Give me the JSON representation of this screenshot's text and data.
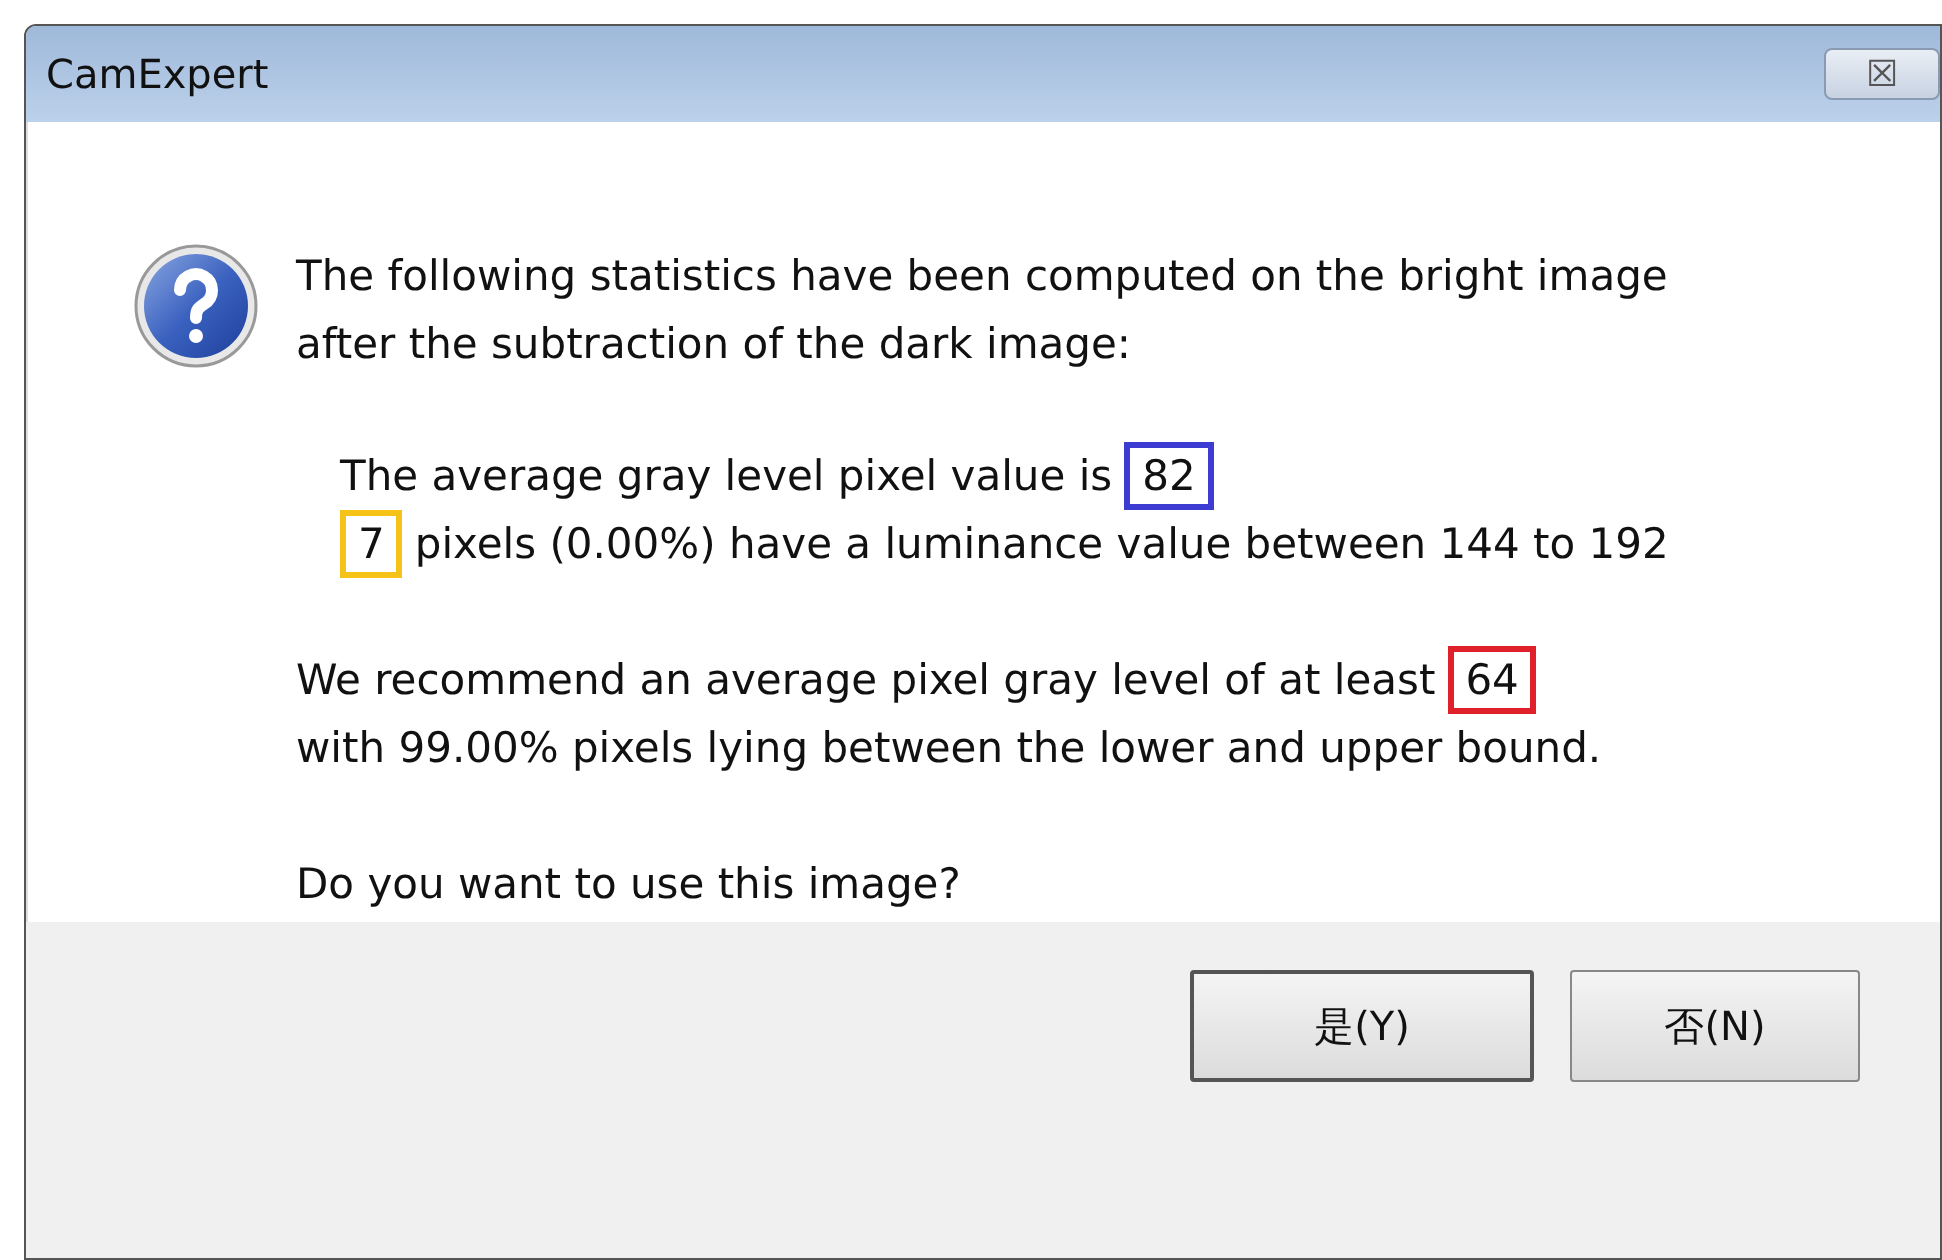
{
  "window": {
    "title": "CamExpert",
    "close_glyph": "☒"
  },
  "message": {
    "intro": [
      "The following statistics have been computed on the bright image",
      "after the subtraction of the dark image:"
    ],
    "stats": [
      {
        "before": "The average gray level pixel value is",
        "value": "82",
        "color": "#3c3cd2"
      },
      {
        "value": "7",
        "color": "#f5c218",
        "after": "pixels (0.00%) have a luminance value between 144 to 192"
      }
    ],
    "recommendation": [
      {
        "before": "We recommend an average pixel gray level of at least",
        "value": "64",
        "color": "#e0202a"
      },
      {
        "before": "with 99.00% pixels lying between the lower and upper bound."
      }
    ],
    "question": "Do you want to use this image?"
  },
  "buttons": [
    {
      "label": "是(Y)",
      "default": true
    },
    {
      "label": "否(N)",
      "default": false
    }
  ]
}
